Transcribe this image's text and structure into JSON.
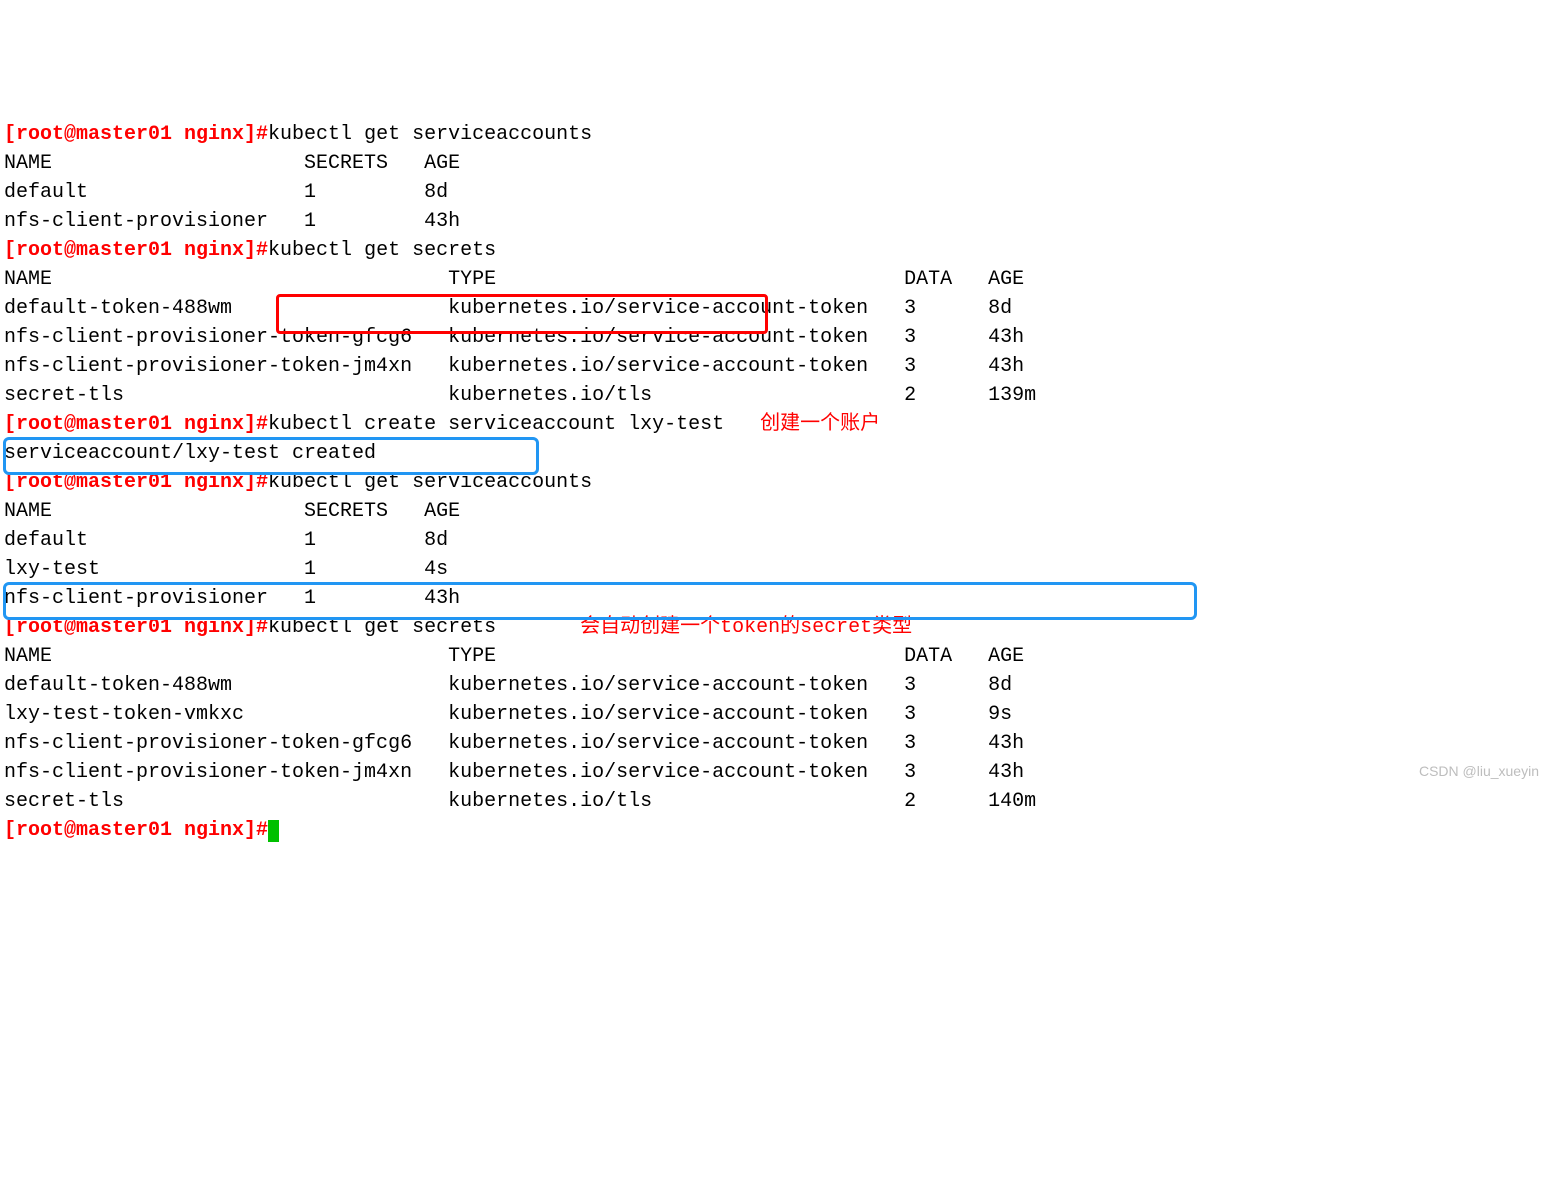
{
  "prompt": "[root@master01 nginx]#",
  "commands": {
    "get_sa": "kubectl get serviceaccounts",
    "get_secrets": "kubectl get secrets",
    "create_sa": "kubectl create serviceaccount lxy-test"
  },
  "annotations": {
    "create_account": "创建一个账户",
    "auto_secret": "会自动创建一个token的secret类型"
  },
  "sa_header": "NAME                     SECRETS   AGE",
  "sa_rows_1": [
    "default                  1         8d",
    "nfs-client-provisioner   1         43h"
  ],
  "sa_rows_2": [
    "default                  1         8d",
    "lxy-test                 1         4s",
    "nfs-client-provisioner   1         43h"
  ],
  "secrets_header": "NAME                                 TYPE                                  DATA   AGE",
  "secrets_rows_1": [
    "default-token-488wm                  kubernetes.io/service-account-token   3      8d",
    "nfs-client-provisioner-token-gfcg6   kubernetes.io/service-account-token   3      43h",
    "nfs-client-provisioner-token-jm4xn   kubernetes.io/service-account-token   3      43h",
    "secret-tls                           kubernetes.io/tls                     2      139m"
  ],
  "secrets_rows_2": [
    "default-token-488wm                  kubernetes.io/service-account-token   3      8d",
    "lxy-test-token-vmkxc                 kubernetes.io/service-account-token   3      9s",
    "nfs-client-provisioner-token-gfcg6   kubernetes.io/service-account-token   3      43h",
    "nfs-client-provisioner-token-jm4xn   kubernetes.io/service-account-token   3      43h",
    "secret-tls                           kubernetes.io/tls                     2      140m"
  ],
  "create_output": "serviceaccount/lxy-test created",
  "watermark": "CSDN @liu_xueyin"
}
